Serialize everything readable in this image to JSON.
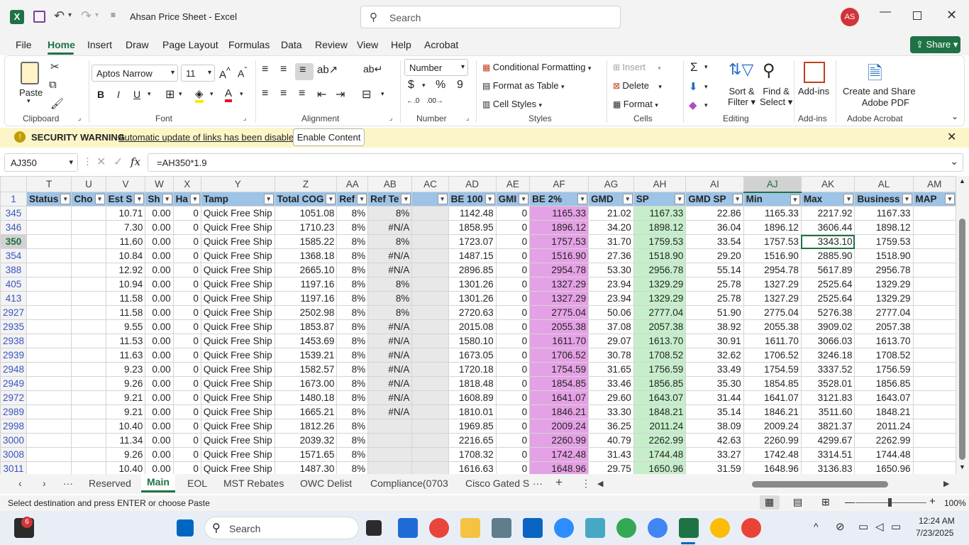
{
  "title": {
    "file": "Ahsan Price Sheet",
    "app": "Excel",
    "search_placeholder": "Search",
    "avatar": "AS"
  },
  "menu": [
    "File",
    "Home",
    "Insert",
    "Draw",
    "Page Layout",
    "Formulas",
    "Data",
    "Review",
    "View",
    "Help",
    "Acrobat"
  ],
  "share": "Share",
  "ribbon": {
    "paste": "Paste",
    "clipboard": "Clipboard",
    "font_name": "Aptos Narrow",
    "font_size": "11",
    "font": "Font",
    "alignment": "Alignment",
    "number_format": "Number",
    "number": "Number",
    "cond_fmt": "Conditional Formatting",
    "fmt_table": "Format as Table",
    "cell_styles": "Cell Styles",
    "styles": "Styles",
    "insert": "Insert",
    "delete": "Delete",
    "format": "Format",
    "cells": "Cells",
    "sort_filter": "Sort &",
    "sort_filter2": "Filter",
    "find_select": "Find &",
    "find_select2": "Select",
    "editing": "Editing",
    "addins": "Add-ins",
    "addins_grp": "Add-ins",
    "create_pdf": "Create and Share",
    "create_pdf2": "Adobe PDF",
    "acrobat": "Adobe Acrobat"
  },
  "security": {
    "title": "SECURITY WARNING",
    "message": "Automatic update of links has been disabled",
    "button": "Enable Content"
  },
  "formula": {
    "namebox": "AJ350",
    "fx": "fx",
    "value": "=AH350*1.9"
  },
  "columns": [
    "T",
    "U",
    "V",
    "W",
    "X",
    "Y",
    "Z",
    "AA",
    "AB",
    "AC",
    "AD",
    "AE",
    "AF",
    "AG",
    "AH",
    "AI",
    "AJ",
    "AK",
    "AL",
    "AM"
  ],
  "headers": [
    "Status",
    "Cho",
    "Est S",
    "Sh",
    "Ha",
    "Tamp",
    "Total COG",
    "Ref",
    "Ref Te",
    "",
    "BE 100",
    "GMI",
    "BE 2%",
    "GMD",
    "SP",
    "GMD SP",
    "Min",
    "Max",
    "Business",
    "MAP"
  ],
  "rows": [
    {
      "n": "345",
      "v": [
        "",
        "",
        "10.71",
        "0.00",
        "0",
        "Quick Free Ship",
        "1051.08",
        "8%",
        "8%",
        "",
        "1142.48",
        "0",
        "1165.33",
        "21.02",
        "1167.33",
        "22.86",
        "1165.33",
        "2217.92",
        "1167.33",
        ""
      ]
    },
    {
      "n": "346",
      "v": [
        "",
        "",
        "7.30",
        "0.00",
        "0",
        "Quick Free Ship",
        "1710.23",
        "8%",
        "#N/A",
        "",
        "1858.95",
        "0",
        "1896.12",
        "34.20",
        "1898.12",
        "36.04",
        "1896.12",
        "3606.44",
        "1898.12",
        ""
      ]
    },
    {
      "n": "350",
      "v": [
        "",
        "",
        "11.60",
        "0.00",
        "0",
        "Quick Free Ship",
        "1585.22",
        "8%",
        "8%",
        "",
        "1723.07",
        "0",
        "1757.53",
        "31.70",
        "1759.53",
        "33.54",
        "1757.53",
        "3343.10",
        "1759.53",
        ""
      ]
    },
    {
      "n": "354",
      "v": [
        "",
        "",
        "10.84",
        "0.00",
        "0",
        "Quick Free Ship",
        "1368.18",
        "8%",
        "#N/A",
        "",
        "1487.15",
        "0",
        "1516.90",
        "27.36",
        "1518.90",
        "29.20",
        "1516.90",
        "2885.90",
        "1518.90",
        ""
      ]
    },
    {
      "n": "388",
      "v": [
        "",
        "",
        "12.92",
        "0.00",
        "0",
        "Quick Free Ship",
        "2665.10",
        "8%",
        "#N/A",
        "",
        "2896.85",
        "0",
        "2954.78",
        "53.30",
        "2956.78",
        "55.14",
        "2954.78",
        "5617.89",
        "2956.78",
        ""
      ]
    },
    {
      "n": "405",
      "v": [
        "",
        "",
        "10.94",
        "0.00",
        "0",
        "Quick Free Ship",
        "1197.16",
        "8%",
        "8%",
        "",
        "1301.26",
        "0",
        "1327.29",
        "23.94",
        "1329.29",
        "25.78",
        "1327.29",
        "2525.64",
        "1329.29",
        ""
      ]
    },
    {
      "n": "413",
      "v": [
        "",
        "",
        "11.58",
        "0.00",
        "0",
        "Quick Free Ship",
        "1197.16",
        "8%",
        "8%",
        "",
        "1301.26",
        "0",
        "1327.29",
        "23.94",
        "1329.29",
        "25.78",
        "1327.29",
        "2525.64",
        "1329.29",
        ""
      ]
    },
    {
      "n": "2927",
      "v": [
        "",
        "",
        "11.58",
        "0.00",
        "0",
        "Quick Free Ship",
        "2502.98",
        "8%",
        "8%",
        "",
        "2720.63",
        "0",
        "2775.04",
        "50.06",
        "2777.04",
        "51.90",
        "2775.04",
        "5276.38",
        "2777.04",
        ""
      ]
    },
    {
      "n": "2935",
      "v": [
        "",
        "",
        "9.55",
        "0.00",
        "0",
        "Quick Free Ship",
        "1853.87",
        "8%",
        "#N/A",
        "",
        "2015.08",
        "0",
        "2055.38",
        "37.08",
        "2057.38",
        "38.92",
        "2055.38",
        "3909.02",
        "2057.38",
        ""
      ]
    },
    {
      "n": "2938",
      "v": [
        "",
        "",
        "11.53",
        "0.00",
        "0",
        "Quick Free Ship",
        "1453.69",
        "8%",
        "#N/A",
        "",
        "1580.10",
        "0",
        "1611.70",
        "29.07",
        "1613.70",
        "30.91",
        "1611.70",
        "3066.03",
        "1613.70",
        ""
      ]
    },
    {
      "n": "2939",
      "v": [
        "",
        "",
        "11.63",
        "0.00",
        "0",
        "Quick Free Ship",
        "1539.21",
        "8%",
        "#N/A",
        "",
        "1673.05",
        "0",
        "1706.52",
        "30.78",
        "1708.52",
        "32.62",
        "1706.52",
        "3246.18",
        "1708.52",
        ""
      ]
    },
    {
      "n": "2948",
      "v": [
        "",
        "",
        "9.23",
        "0.00",
        "0",
        "Quick Free Ship",
        "1582.57",
        "8%",
        "#N/A",
        "",
        "1720.18",
        "0",
        "1754.59",
        "31.65",
        "1756.59",
        "33.49",
        "1754.59",
        "3337.52",
        "1756.59",
        ""
      ]
    },
    {
      "n": "2949",
      "v": [
        "",
        "",
        "9.26",
        "0.00",
        "0",
        "Quick Free Ship",
        "1673.00",
        "8%",
        "#N/A",
        "",
        "1818.48",
        "0",
        "1854.85",
        "33.46",
        "1856.85",
        "35.30",
        "1854.85",
        "3528.01",
        "1856.85",
        ""
      ]
    },
    {
      "n": "2972",
      "v": [
        "",
        "",
        "9.21",
        "0.00",
        "0",
        "Quick Free Ship",
        "1480.18",
        "8%",
        "#N/A",
        "",
        "1608.89",
        "0",
        "1641.07",
        "29.60",
        "1643.07",
        "31.44",
        "1641.07",
        "3121.83",
        "1643.07",
        ""
      ]
    },
    {
      "n": "2989",
      "v": [
        "",
        "",
        "9.21",
        "0.00",
        "0",
        "Quick Free Ship",
        "1665.21",
        "8%",
        "#N/A",
        "",
        "1810.01",
        "0",
        "1846.21",
        "33.30",
        "1848.21",
        "35.14",
        "1846.21",
        "3511.60",
        "1848.21",
        ""
      ]
    },
    {
      "n": "2998",
      "v": [
        "",
        "",
        "10.40",
        "0.00",
        "0",
        "Quick Free Ship",
        "1812.26",
        "8%",
        "",
        "",
        "1969.85",
        "0",
        "2009.24",
        "36.25",
        "2011.24",
        "38.09",
        "2009.24",
        "3821.37",
        "2011.24",
        ""
      ]
    },
    {
      "n": "3000",
      "v": [
        "",
        "",
        "11.34",
        "0.00",
        "0",
        "Quick Free Ship",
        "2039.32",
        "8%",
        "",
        "",
        "2216.65",
        "0",
        "2260.99",
        "40.79",
        "2262.99",
        "42.63",
        "2260.99",
        "4299.67",
        "2262.99",
        ""
      ]
    },
    {
      "n": "3008",
      "v": [
        "",
        "",
        "9.26",
        "0.00",
        "0",
        "Quick Free Ship",
        "1571.65",
        "8%",
        "",
        "",
        "1708.32",
        "0",
        "1742.48",
        "31.43",
        "1744.48",
        "33.27",
        "1742.48",
        "3314.51",
        "1744.48",
        ""
      ]
    },
    {
      "n": "3011",
      "v": [
        "",
        "",
        "10.40",
        "0.00",
        "0",
        "Quick Free Ship",
        "1487.30",
        "8%",
        "",
        "",
        "1616.63",
        "0",
        "1648.96",
        "29.75",
        "1650.96",
        "31.59",
        "1648.96",
        "3136.83",
        "1650.96",
        ""
      ]
    }
  ],
  "sheets": [
    "Reserved",
    "Main",
    "EOL",
    "MST Rebates",
    "OWC Delist",
    "Compliance(0703",
    "Cisco Gated S"
  ],
  "active_sheet": "Main",
  "status_text": "Select destination and press ENTER or choose Paste",
  "zoom": "100%",
  "taskbar": {
    "search": "Search",
    "time": "12:24 AM",
    "date": "7/23/2025",
    "badge": "6"
  },
  "colors": {
    "excel_green": "#1f7244",
    "header_blue": "#9dc3e6",
    "pink": "#e5a1e5",
    "green_fill": "#c6eecb"
  }
}
